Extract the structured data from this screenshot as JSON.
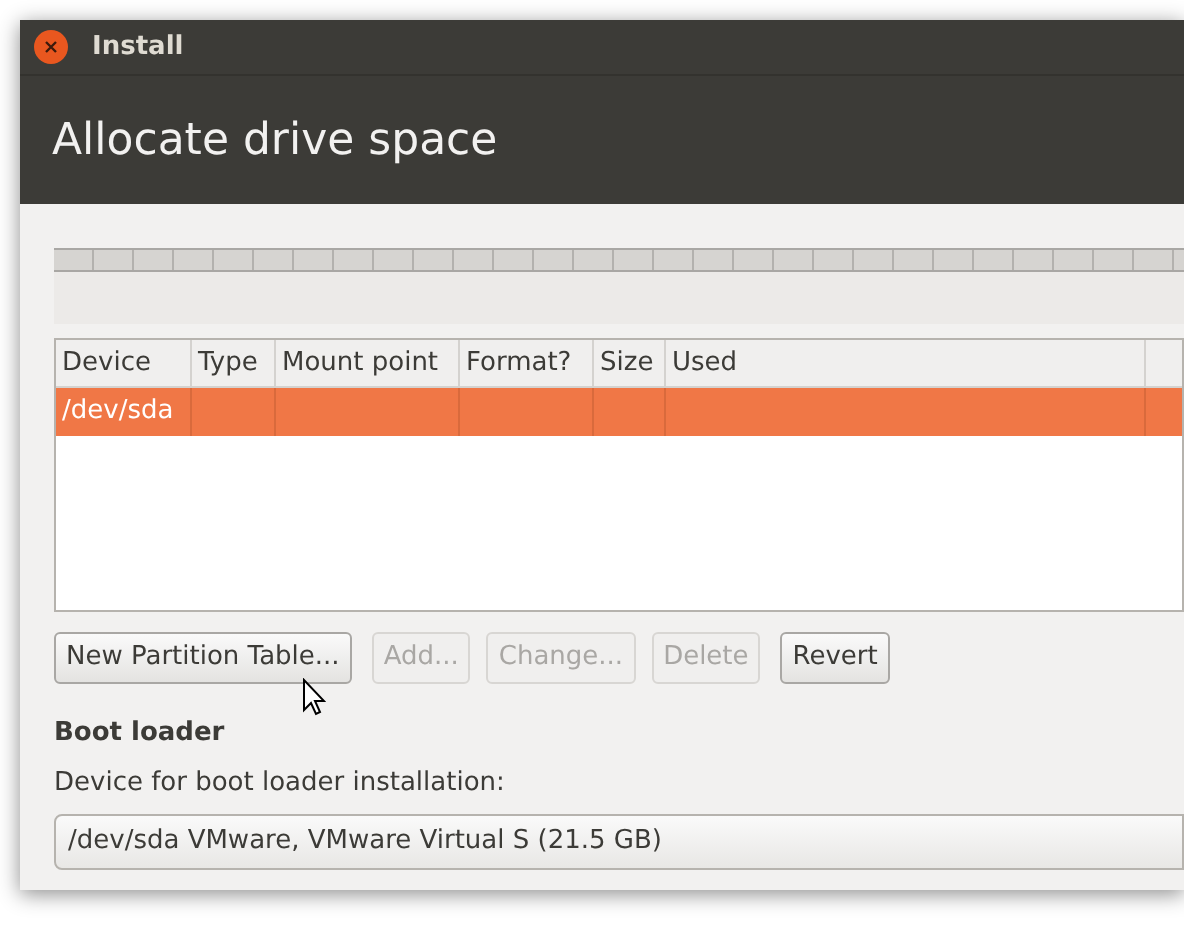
{
  "window": {
    "title": "Install"
  },
  "header": {
    "title": "Allocate drive space"
  },
  "table": {
    "columns": [
      "Device",
      "Type",
      "Mount point",
      "Format?",
      "Size",
      "Used"
    ],
    "rows": [
      {
        "cells": [
          "/dev/sda",
          "",
          "",
          "",
          "",
          ""
        ],
        "selected": true
      }
    ]
  },
  "buttons": [
    {
      "label": "New Partition Table...",
      "disabled": false
    },
    {
      "label": "Add...",
      "disabled": true
    },
    {
      "label": "Change...",
      "disabled": true
    },
    {
      "label": "Delete",
      "disabled": true
    },
    {
      "label": "Revert",
      "disabled": false
    }
  ],
  "boot_loader": {
    "heading": "Boot loader",
    "label": "Device for boot loader installation:",
    "value": "/dev/sda VMware, VMware Virtual S (21.5 GB)"
  }
}
